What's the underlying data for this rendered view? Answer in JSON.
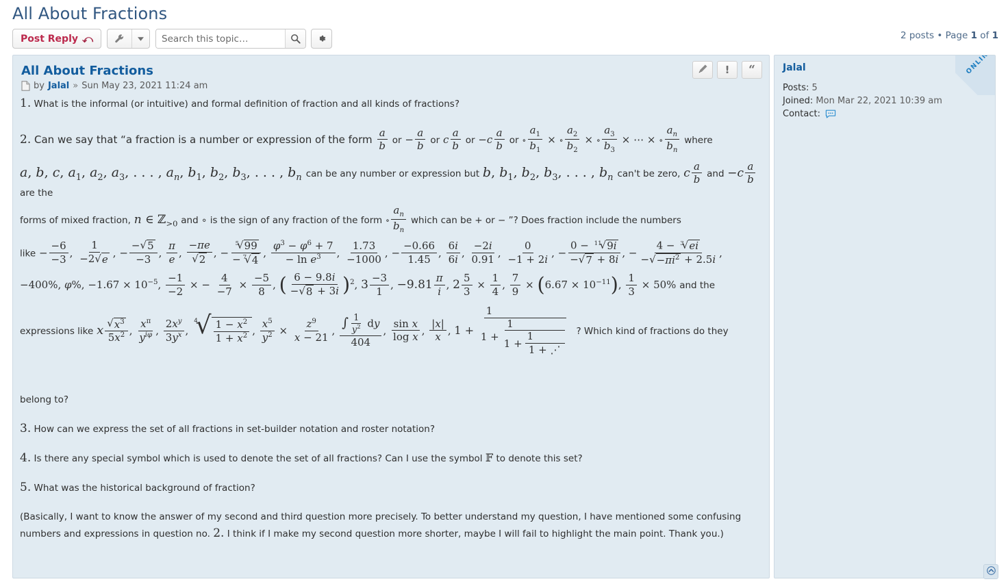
{
  "header": {
    "topic_title": "All About Fractions",
    "pagination": "2 posts • Page 1 of 1",
    "pagination_parts": {
      "posts": "2 posts",
      "bullet": "•",
      "page_word": "Page",
      "current": "1",
      "of_word": "of",
      "total": "1"
    }
  },
  "toolbar": {
    "post_reply_label": "Post Reply",
    "post_reply_icon": "reply-arrow-icon",
    "tools_icon": "wrench-icon",
    "tools_caret_icon": "caret-down-icon",
    "search_placeholder": "Search this topic…",
    "search_value": "",
    "search_icon": "magnifier-icon",
    "settings_icon": "gear-icon"
  },
  "post": {
    "title": "All About Fractions",
    "by_label": "by",
    "author": "Jalal",
    "separator": "»",
    "date": "Sun May 23, 2021 11:24 am",
    "doc_icon": "document-icon",
    "tools": {
      "edit_icon": "pencil-icon",
      "report_icon": "exclamation-icon",
      "quote_icon": "quote-icon"
    }
  },
  "profile": {
    "username": "Jalal",
    "posts_label": "Posts:",
    "posts_value": "5",
    "joined_label": "Joined:",
    "joined_value": "Mon Mar 22, 2021 10:39 am",
    "contact_label": "Contact:",
    "contact_icon": "pm-bubble-icon",
    "online_badge": "ONLINE"
  },
  "footer": {
    "to_top_icon": "chevron-up-icon"
  },
  "content": {
    "q1_num": "1.",
    "q1_text": "What is the informal (or intuitive) and formal definition of fraction and all kinds of fractions?",
    "q2_num": "2.",
    "q2_a": "Can we say that “a fraction is a number or expression of the form",
    "q2_or1": "or",
    "q2_or2": "or",
    "q2_or3": "or",
    "q2_or4": "or",
    "q2_where": "where",
    "q2_b": "can be any number or expression but",
    "q2_cantbezero": "can't be zero,",
    "q2_and": "and",
    "q2_arethe": "are the",
    "q2_c": "forms of mixed fraction,",
    "q2_d": "and ∘ is the sign of any fraction of the form",
    "q2_e": "which can be + or − ”? Does fraction include the numbers",
    "q2_like": "like",
    "q2_andthe": "and the",
    "q2_expr": "expressions like",
    "q2_which_kind": "? Which kind of fractions do they",
    "q2_belong": "belong to?",
    "q3_num": "3.",
    "q3_text": "How can we express the set of all fractions in set-builder notation and roster notation?",
    "q4_num": "4.",
    "q4_text_a": "Is there any special symbol which is used to denote the set of all fractions? Can I use the symbol",
    "q4_symbol": "𝔽",
    "q4_text_b": "to denote this set?",
    "q5_num": "5.",
    "q5_text": "What was the historical background of fraction?",
    "closing_a": "(Basically, I want to know the answer of my second and third question more precisely. To better understand my question, I have mentioned some confusing numbers and expressions in question no.",
    "closing_num": "2.",
    "closing_b": "I think if I make my second question more shorter, maybe I will fail to highlight the main point. Thank you.)"
  },
  "math": {
    "a": "a",
    "b": "b",
    "c": "c",
    "n": "n",
    "circ": "∘",
    "times": "×",
    "cdots": "⋯",
    "varlist": "a, b, c, a₁, a₂, a₃, …, aₙ, b₁, b₂, b₃, …, bₙ",
    "blist": "b, b₁, b₂, b₃, …, bₙ",
    "nz": "n ∈ ℤ>0",
    "fraclist_1": "−6/−3",
    "fraclist_2": "1/−2√e",
    "fraclist_3": "−(−√5/−3)",
    "fraclist_4": "π/e",
    "fraclist_5": "−πe/√2",
    "fraclist_6": "−(−⁵√99 / −⁷√4)",
    "fraclist_7": "(φ³ − φ⁶ + 7)/(− ln e³)",
    "fraclist_8": "1.73/−1000",
    "fraclist_9": "−(−0.66/1.45)",
    "fraclist_10": "6i/6i",
    "fraclist_11": "−2i/0.91",
    "fraclist_12": "0/(−1+2i)",
    "fraclist_13": "−((0 − ¹¹√9 i)/(−√7 + 8i))",
    "fraclist_14": "−((4 − ³√(ei))/(−√(−πi²) + 2.5i))",
    "row3_1": "−400%",
    "row3_2": "φ%",
    "row3_3": "−1.67 × 10⁻⁵",
    "row3_4": "−1/−2 × −4/−7 × −5/8",
    "row3_5": "((6 − 9.8i)/(−√8 + 3i))²",
    "row3_6": "3 −3/1",
    "row3_7": "−9.81 π/i",
    "row3_8": "2 5/3 × 1/4",
    "row3_9": "7/9 × (6.67 × 10⁻¹¹)",
    "row3_10": "1/3 × 50%",
    "row4_1": "x √(x³)/5x²",
    "row4_2": "xᵖⁱ/y^(iφ)",
    "row4_3": "2x^y/3y^x",
    "row4_4": "⁴√((1−x²)/(1+x²))",
    "row4_5": "x⁵/y²",
    "row4_6": "z⁹/(x−21)",
    "row4_7": "∫ (1/y²) dy / 404",
    "row4_8": "sin x / log x",
    "row4_9": "|x|/x",
    "row4_10": "1 + 1/(1 + 1/(1 + 1/(1 + ⋰)))"
  }
}
